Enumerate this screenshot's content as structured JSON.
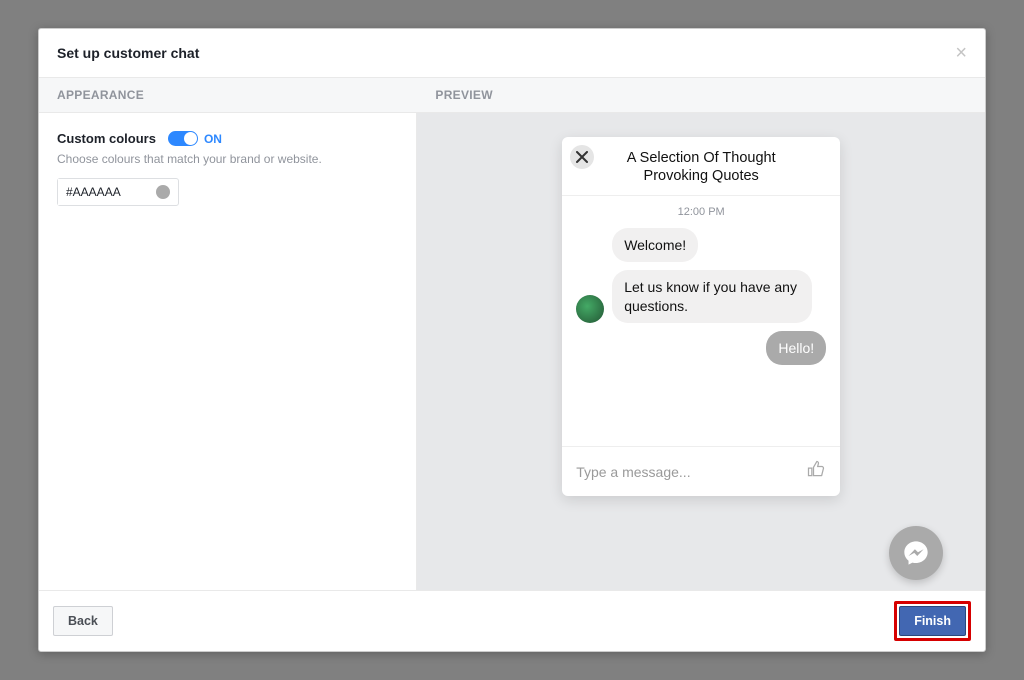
{
  "modal": {
    "title": "Set up customer chat",
    "headers": {
      "left": "APPEARANCE",
      "right": "PREVIEW"
    }
  },
  "appearance": {
    "custom_colours_label": "Custom colours",
    "toggle_state": "ON",
    "description": "Choose colours that match your brand or website.",
    "color_value": "#AAAAAA"
  },
  "chat": {
    "title": "A Selection Of Thought Provoking Quotes",
    "time": "12:00 PM",
    "messages": [
      {
        "text": "Welcome!",
        "side": "received",
        "show_avatar": false
      },
      {
        "text": "Let us know if you have any questions.",
        "side": "received",
        "show_avatar": true
      },
      {
        "text": "Hello!",
        "side": "sent"
      }
    ],
    "input_placeholder": "Type a message..."
  },
  "footer": {
    "back": "Back",
    "finish": "Finish"
  },
  "colors": {
    "accent": "#AAAAAA"
  }
}
